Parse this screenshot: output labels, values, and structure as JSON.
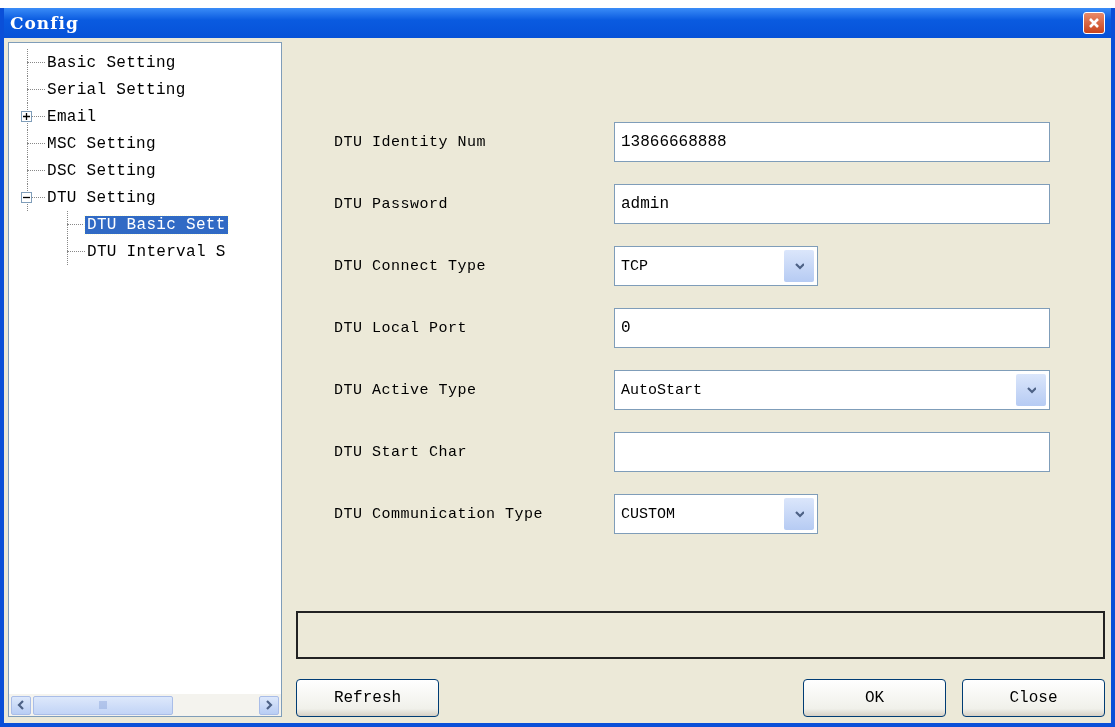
{
  "window": {
    "title": "Config"
  },
  "tree": [
    {
      "label": "Basic Setting",
      "selected": false
    },
    {
      "label": "Serial Setting",
      "selected": false
    },
    {
      "label": "Email",
      "selected": false,
      "expanded": false
    },
    {
      "label": "MSC Setting",
      "selected": false
    },
    {
      "label": "DSC Setting",
      "selected": false
    },
    {
      "label": "DTU Setting",
      "selected": false,
      "expanded": true,
      "children": [
        {
          "label": "DTU Basic Sett",
          "selected": true
        },
        {
          "label": "DTU Interval S",
          "selected": false
        }
      ]
    }
  ],
  "fields": [
    {
      "label": "DTU Identity Num",
      "kind": "text",
      "value": "13866668888"
    },
    {
      "label": "DTU Password",
      "kind": "text",
      "value": "admin"
    },
    {
      "label": "DTU Connect Type",
      "kind": "select",
      "value": "TCP"
    },
    {
      "label": "DTU Local Port",
      "kind": "text",
      "value": "0"
    },
    {
      "label": "DTU Active Type",
      "kind": "wideselect",
      "value": "AutoStart"
    },
    {
      "label": "DTU Start Char",
      "kind": "text"
    },
    {
      "label": "DTU Communication Type",
      "kind": "select",
      "value": "CUSTOM"
    }
  ],
  "buttons": [
    {
      "label": "Refresh"
    },
    {
      "label": "OK"
    },
    {
      "label": "Close"
    }
  ]
}
